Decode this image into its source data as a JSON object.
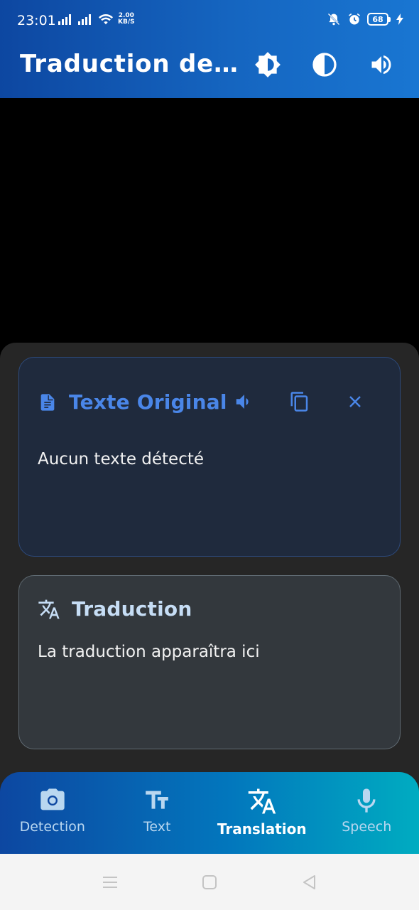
{
  "status_bar": {
    "time": "23:01",
    "network_speed_value": "2.00",
    "network_speed_unit": "KB/S",
    "battery": "68"
  },
  "app_bar": {
    "title": "Traduction de…",
    "actions": [
      "brightness-icon",
      "contrast-icon",
      "volume-icon"
    ]
  },
  "original_card": {
    "title": "Texte Original",
    "body": "Aucun texte détecté",
    "actions": [
      "volume-icon",
      "copy-icon",
      "close-icon"
    ],
    "accent": "#4a86e8"
  },
  "translation_card": {
    "title": "Traduction",
    "body": "La traduction apparaîtra ici",
    "accent": "#c6ddf5"
  },
  "bottom_nav": {
    "items": [
      {
        "label": "Detection",
        "icon": "camera-icon",
        "active": false
      },
      {
        "label": "Text",
        "icon": "text-fields-icon",
        "active": false
      },
      {
        "label": "Translation",
        "icon": "translate-icon",
        "active": true
      },
      {
        "label": "Speech",
        "icon": "microphone-icon",
        "active": false
      }
    ]
  },
  "colors": {
    "app_bar_start": "#0d47a1",
    "app_bar_end": "#1976d2",
    "nav_end": "#00acc1",
    "sheet_bg": "#262626"
  }
}
